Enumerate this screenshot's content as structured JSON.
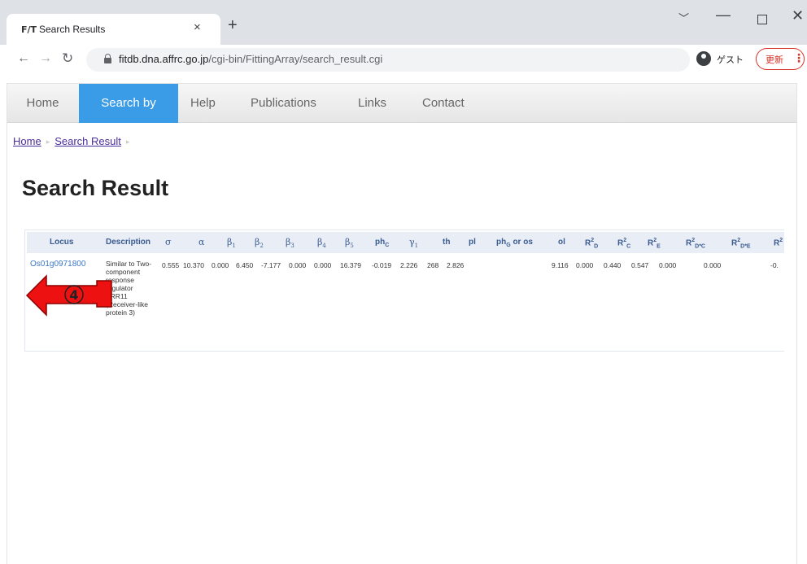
{
  "browser": {
    "tab_title": "Search Results",
    "tab_favicon_text": "F/T",
    "tab_close": "×",
    "new_tab": "+",
    "url_host": "fitdb.dna.affrc.go.jp",
    "url_path": "/cgi-bin/FittingArray/search_result.cgi",
    "profile_label": "ゲスト",
    "update_label": "更新",
    "update_menu": "⋮"
  },
  "navbar": {
    "items": [
      "Home",
      "Search by",
      "Help",
      "Publications",
      "Links",
      "Contact"
    ],
    "active": "Search by"
  },
  "breadcrumb": {
    "items": [
      "Home",
      "Search Result"
    ],
    "separator": "▸"
  },
  "page_title": "Search Result",
  "table": {
    "headers": {
      "locus": "Locus",
      "description": "Description",
      "sigma": "σ",
      "alpha": "α",
      "beta1": "β1",
      "beta2": "β2",
      "beta3": "β3",
      "beta4": "β4",
      "beta5": "β5",
      "phc": "phC",
      "gamma1": "γ1",
      "th": "th",
      "pl": "pl",
      "phg_or_os": "phG or os",
      "ol": "ol",
      "r2d": "R2D",
      "r2c": "R2C",
      "r2e": "R2E",
      "r2dc": "R2D*C",
      "r2de": "R2D*E",
      "r2_cut": "R2"
    },
    "row": {
      "locus": "Os01g0971800",
      "description": "Similar to Two-component response regulator ARR11 (Receiver-like protein 3)",
      "sigma": "0.555",
      "alpha": "10.370",
      "beta1": "0.000",
      "beta2": "6.450",
      "beta3": "-7.177",
      "beta4": "0.000",
      "beta5": "0.000",
      "phc": "16.379",
      "gamma1": "-0.019",
      "th": "2.226",
      "pl": "268",
      "phg_or_os": "2.826",
      "ol": "9.116",
      "r2d": "0.000",
      "r2c": "0.440",
      "r2e": "0.547",
      "r2dc": "0.000",
      "r2de": "0.000",
      "r2_cut": "-0."
    }
  },
  "annotation": {
    "label": "④",
    "color": "#ee1111"
  },
  "colors": {
    "accent": "#3a9be6",
    "link": "#3b78c9",
    "header_bg": "#e8edf6",
    "update_red": "#d93025"
  }
}
